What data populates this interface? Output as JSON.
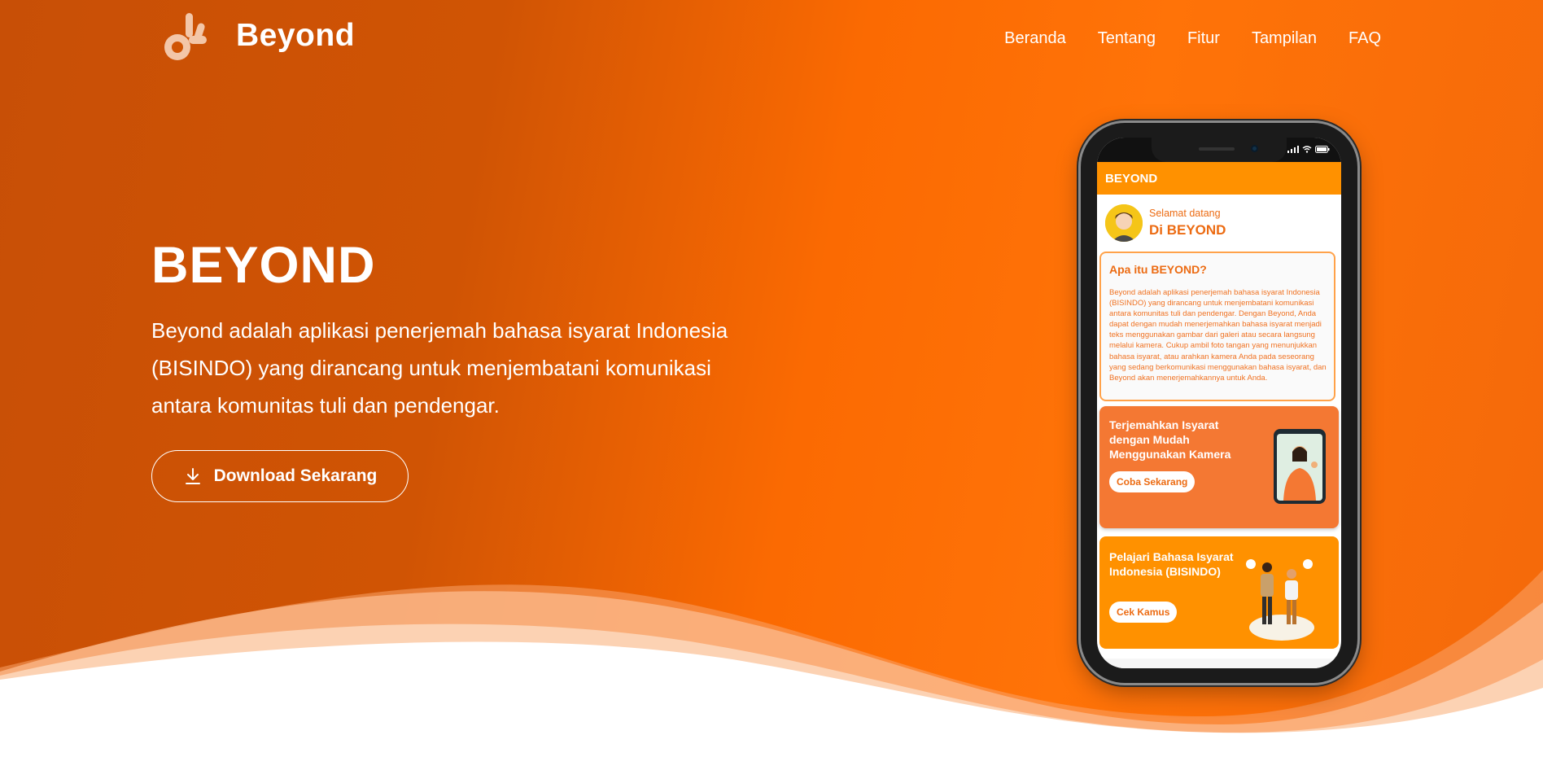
{
  "brand": {
    "name": "Beyond"
  },
  "nav": {
    "items": [
      "Beranda",
      "Tentang",
      "Fitur",
      "Tampilan",
      "FAQ"
    ]
  },
  "hero": {
    "title": "BEYOND",
    "description": "Beyond adalah aplikasi penerjemah bahasa isyarat Indonesia (BISINDO) yang dirancang untuk menjembatani komunikasi antara komunitas tuli dan pendengar.",
    "download_label": "Download Sekarang"
  },
  "phone_app": {
    "appbar_title": "BEYOND",
    "welcome_small": "Selamat datang",
    "welcome_big": "Di BEYOND",
    "about_title": "Apa itu BEYOND?",
    "about_text": "Beyond adalah aplikasi penerjemah bahasa isyarat Indonesia (BISINDO) yang dirancang untuk menjembatani komunikasi antara komunitas tuli dan pendengar. Dengan Beyond, Anda dapat dengan mudah menerjemahkan bahasa isyarat menjadi teks menggunakan gambar dari galeri atau secara langsung melalui kamera. Cukup ambil foto tangan yang menunjukkan bahasa isyarat, atau arahkan kamera Anda pada seseorang yang sedang berkomunikasi menggunakan bahasa isyarat, dan Beyond akan menerjemahkannya untuk Anda.",
    "camera_card_title": "Terjemahkan Isyarat dengan Mudah Menggunakan Kamera",
    "camera_card_button": "Coba Sekarang",
    "dict_card_title": "Pelajari Bahasa Isyarat Indonesia (BISINDO)",
    "dict_card_button": "Cek Kamus"
  },
  "colors": {
    "accent": "#ff9100",
    "hero_dark": "#c84f06",
    "hero_light": "#ff7308",
    "text_orange": "#ec6b12"
  }
}
